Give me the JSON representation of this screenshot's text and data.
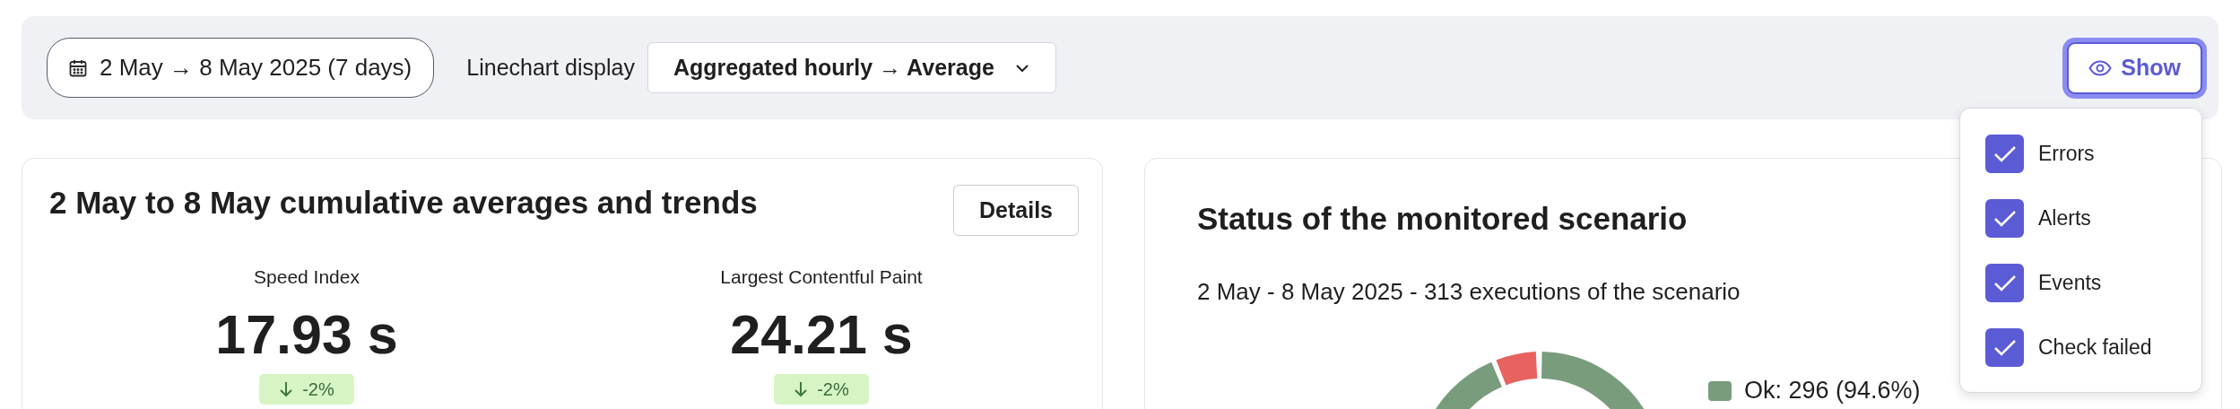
{
  "toolbar": {
    "date_range": "2 May → 8 May 2025 (7 days)",
    "linechart_label": "Linechart display",
    "linechart_select": "Aggregated hourly → Average",
    "show_button": "Show"
  },
  "show_menu": {
    "items": [
      {
        "label": "Errors",
        "checked": true
      },
      {
        "label": "Alerts",
        "checked": true
      },
      {
        "label": "Events",
        "checked": true
      },
      {
        "label": "Check failed",
        "checked": true
      }
    ]
  },
  "averages_card": {
    "title": "2 May to 8 May cumulative averages and trends",
    "details_button": "Details",
    "metrics": [
      {
        "name": "Speed Index",
        "value": "17.93 s",
        "trend": "-2%"
      },
      {
        "name": "Largest Contentful Paint",
        "value": "24.21 s",
        "trend": "-2%"
      }
    ]
  },
  "status_card": {
    "title": "Status of the monitored scenario",
    "subtitle": "2 May - 8 May 2025 - 313 executions of the scenario",
    "legend": [
      {
        "label": "Ok: 296 (94.6%)",
        "color": "#789c7c"
      }
    ]
  }
}
